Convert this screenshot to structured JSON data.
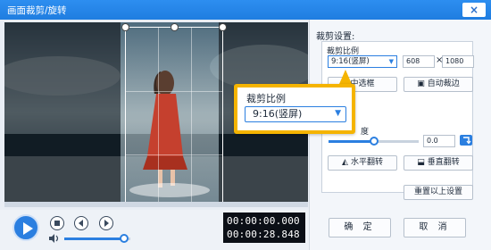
{
  "window": {
    "title": "画面裁剪/旋转",
    "close_label": "×"
  },
  "player": {
    "current_time": "00:00:00.000",
    "total_time": "00:00:28.848",
    "scrub_progress": 0.0,
    "volume_level": 0.9
  },
  "crop_settings": {
    "section_title": "裁剪设置:",
    "ratio_label": "裁剪比例",
    "ratio_value": "9:16(竖屏)",
    "width": "608",
    "height": "1080",
    "times_sign": "×",
    "center_button": "中选框",
    "auto_crop_button": "自动裁边"
  },
  "rotate_settings": {
    "angle_label": "度",
    "angle_value": "0.0",
    "angle_slider_level": 0.5,
    "flip_horizontal_button": "水平翻转",
    "flip_vertical_button": "垂直翻转",
    "reset_button": "重置以上设置"
  },
  "callout": {
    "title": "裁剪比例",
    "select_value": "9:16(竖屏)"
  },
  "footer": {
    "ok_button": "确 定",
    "cancel_button": "取 消"
  },
  "colors": {
    "accent": "#2b7fe0",
    "titlebar": "#1f7de0",
    "highlight": "#f5b400"
  }
}
